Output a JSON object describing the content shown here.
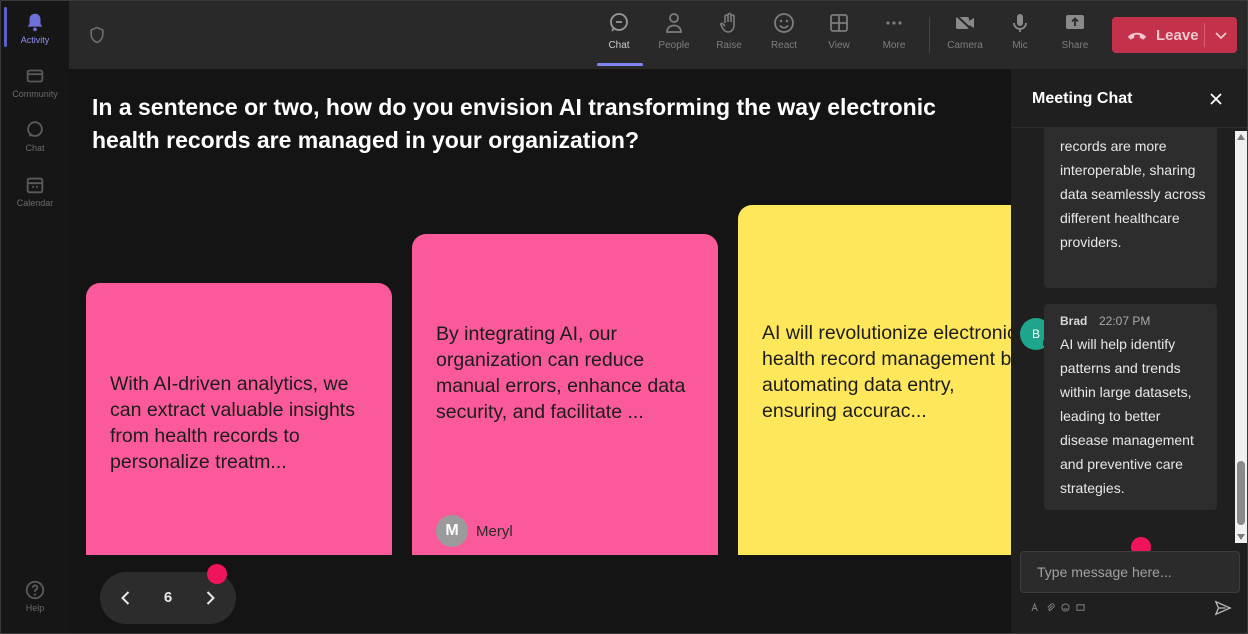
{
  "rail": {
    "items": [
      {
        "label": "Activity",
        "icon": "bell-icon"
      },
      {
        "label": "Community",
        "icon": "community-icon"
      },
      {
        "label": "Chat",
        "icon": "chat-icon"
      },
      {
        "label": "Calendar",
        "icon": "calendar-icon"
      },
      {
        "label": "Help",
        "icon": "help-icon"
      }
    ]
  },
  "toolbar": {
    "chat": "Chat",
    "people": "People",
    "raise": "Raise",
    "react": "React",
    "view": "View",
    "more": "More",
    "camera": "Camera",
    "mic": "Mic",
    "share": "Share",
    "leave": "Leave"
  },
  "question": "In a sentence or two, how do you envision AI transforming the way electronic health records are managed in your organization?",
  "cards": [
    {
      "text": "With AI-driven analytics, we can extract valuable insights from health records to personalize treatm...",
      "color": "#fb5a9a"
    },
    {
      "text": "By integrating AI, our organization can reduce manual errors, enhance data security, and facilitate ...",
      "color": "#fb5a9a",
      "author_initial": "M",
      "author": "Meryl"
    },
    {
      "text": "AI will revolutionize electronic health record management by automating data entry, ensuring accurac...",
      "color": "#ffe75c"
    }
  ],
  "pager": {
    "page": "6"
  },
  "chat": {
    "title": "Meeting Chat",
    "messages": [
      {
        "text": "records are more interoperable, sharing data seamlessly across different healthcare providers."
      },
      {
        "sender": "Brad",
        "initial": "B",
        "time": "22:07 PM",
        "text": "AI will help identify patterns and trends within large datasets, leading to better disease management and preventive care strategies."
      }
    ],
    "input_placeholder": "Type message here..."
  },
  "colors": {
    "accent": "#7f85f5",
    "leave": "#c4314b",
    "notification_dot": "#f0145a",
    "avatar_brad": "#1fa58b"
  }
}
